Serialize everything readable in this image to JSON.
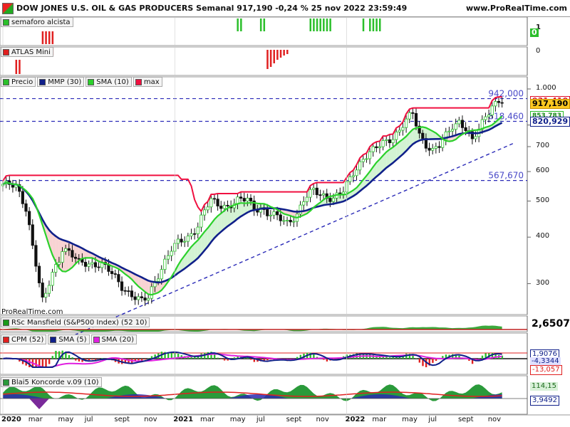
{
  "header": {
    "title": "DOW JONES U.S. OIL & GAS PRODUCERS Semanal 917,190 -0,24 % 25 nov 2022 23:59:49",
    "site": "www.ProRealTime.com"
  },
  "copyright": "ProRealTime.com",
  "panels": {
    "semaforo": {
      "legend": "semaforo alcista",
      "ticks": [
        "1",
        "0"
      ]
    },
    "atlas": {
      "legend": "ATLAS Mini",
      "ticks": [
        "0"
      ]
    },
    "price": {
      "legend": [
        "Precio",
        "MMP (30)",
        "SMA (10)",
        "max"
      ],
      "ticks": [
        "1.000",
        "800",
        "700",
        "600",
        "500",
        "400",
        "300"
      ],
      "levels": [
        {
          "label": "942,000",
          "value": 942
        },
        {
          "label": "818,460",
          "value": 818.46
        },
        {
          "label": "567,670",
          "value": 567.67
        }
      ],
      "badges": [
        {
          "label": "931,410",
          "value": 931.41,
          "color": "#e0102a",
          "bg": "#ffffff",
          "border": "#e0102a"
        },
        {
          "label": "917,190",
          "value": 917.19,
          "color": "#000000",
          "bg": "#ffc820",
          "border": "#c89000"
        },
        {
          "label": "853,783",
          "value": 853.783,
          "color": "#1a8a1a",
          "bg": "#ffffff",
          "border": "#2bbf2b"
        },
        {
          "label": "820,929",
          "value": 820.929,
          "color": "#10208a",
          "bg": "#ffffff",
          "border": "#10208a"
        }
      ]
    },
    "rsc": {
      "legend": "RSc Mansfield (S&P500 Index) (52 10)",
      "last": "2,6507"
    },
    "cpm": {
      "legend": [
        "CPM (52)",
        "SMA (5)",
        "SMA (20)"
      ],
      "labels": [
        "1,9076",
        "-4,3344",
        "-13,057"
      ]
    },
    "koncorde": {
      "legend": "Blai5 Koncorde v.09 (10)",
      "labels": [
        "114,15",
        "3,9492"
      ]
    }
  },
  "x_axis": {
    "labels": [
      {
        "text": "2020",
        "bold": true,
        "week": 0
      },
      {
        "text": "mar",
        "bold": false,
        "week": 9
      },
      {
        "text": "may",
        "bold": false,
        "week": 18
      },
      {
        "text": "jul",
        "bold": false,
        "week": 26
      },
      {
        "text": "sept",
        "bold": false,
        "week": 35
      },
      {
        "text": "nov",
        "bold": false,
        "week": 44
      },
      {
        "text": "2021",
        "bold": true,
        "week": 52
      },
      {
        "text": "mar",
        "bold": false,
        "week": 61
      },
      {
        "text": "may",
        "bold": false,
        "week": 70
      },
      {
        "text": "jul",
        "bold": false,
        "week": 78
      },
      {
        "text": "sept",
        "bold": false,
        "week": 87
      },
      {
        "text": "nov",
        "bold": false,
        "week": 96
      },
      {
        "text": "2022",
        "bold": true,
        "week": 104
      },
      {
        "text": "mar",
        "bold": false,
        "week": 113
      },
      {
        "text": "may",
        "bold": false,
        "week": 122
      },
      {
        "text": "jul",
        "bold": false,
        "week": 130
      },
      {
        "text": "sept",
        "bold": false,
        "week": 139
      },
      {
        "text": "nov",
        "bold": false,
        "week": 148
      }
    ]
  },
  "colors": {
    "up": "#2bbf2b",
    "down": "#111111",
    "mmp": "#10208a",
    "sma": "#2bd12b",
    "max": "#f01040",
    "level": "#2b2bb8",
    "cpm_sma20": "#e020e0",
    "rsc": "#1a9a1a",
    "kon_green": "#2a9a3a",
    "kon_blue": "#2a2ab0",
    "kon_red": "#e02020"
  },
  "chart_data": {
    "type": "line",
    "title": "DOW JONES U.S. OIL & GAS PRODUCERS Semanal",
    "x_unit": "weeks since first week of 2020",
    "y_scale": "log",
    "ylim": [
      250,
      1000
    ],
    "close_anchors": [
      [
        0,
        555
      ],
      [
        4,
        545
      ],
      [
        7,
        480
      ],
      [
        9,
        380
      ],
      [
        11,
        300
      ],
      [
        12,
        268
      ],
      [
        13,
        280
      ],
      [
        15,
        320
      ],
      [
        17,
        350
      ],
      [
        18,
        375
      ],
      [
        20,
        365
      ],
      [
        23,
        340
      ],
      [
        27,
        340
      ],
      [
        30,
        338
      ],
      [
        33,
        318
      ],
      [
        36,
        295
      ],
      [
        39,
        280
      ],
      [
        42,
        268
      ],
      [
        44,
        275
      ],
      [
        46,
        305
      ],
      [
        49,
        345
      ],
      [
        51,
        370
      ],
      [
        53,
        385
      ],
      [
        56,
        400
      ],
      [
        59,
        430
      ],
      [
        61,
        470
      ],
      [
        63,
        500
      ],
      [
        65,
        490
      ],
      [
        68,
        485
      ],
      [
        71,
        500
      ],
      [
        74,
        505
      ],
      [
        76,
        480
      ],
      [
        78,
        480
      ],
      [
        80,
        462
      ],
      [
        83,
        452
      ],
      [
        86,
        440
      ],
      [
        89,
        460
      ],
      [
        91,
        500
      ],
      [
        94,
        535
      ],
      [
        97,
        520
      ],
      [
        100,
        505
      ],
      [
        103,
        530
      ],
      [
        106,
        600
      ],
      [
        109,
        650
      ],
      [
        112,
        680
      ],
      [
        115,
        720
      ],
      [
        118,
        745
      ],
      [
        120,
        770
      ],
      [
        122,
        820
      ],
      [
        124,
        860
      ],
      [
        126,
        760
      ],
      [
        128,
        710
      ],
      [
        130,
        680
      ],
      [
        132,
        700
      ],
      [
        134,
        750
      ],
      [
        136,
        800
      ],
      [
        138,
        820
      ],
      [
        140,
        780
      ],
      [
        142,
        720
      ],
      [
        144,
        780
      ],
      [
        146,
        850
      ],
      [
        148,
        905
      ],
      [
        150,
        925
      ],
      [
        151,
        917
      ]
    ],
    "series": [
      {
        "name": "Precio",
        "value_last": 917.19
      },
      {
        "name": "MMP (30)",
        "value_last": 820.929
      },
      {
        "name": "SMA (10)",
        "value_last": 853.783
      },
      {
        "name": "max",
        "value_last": 931.41
      }
    ],
    "horizontal_levels": [
      942,
      818.46,
      567.67
    ],
    "trendline": [
      [
        20,
        215
      ],
      [
        155,
        718
      ]
    ]
  }
}
